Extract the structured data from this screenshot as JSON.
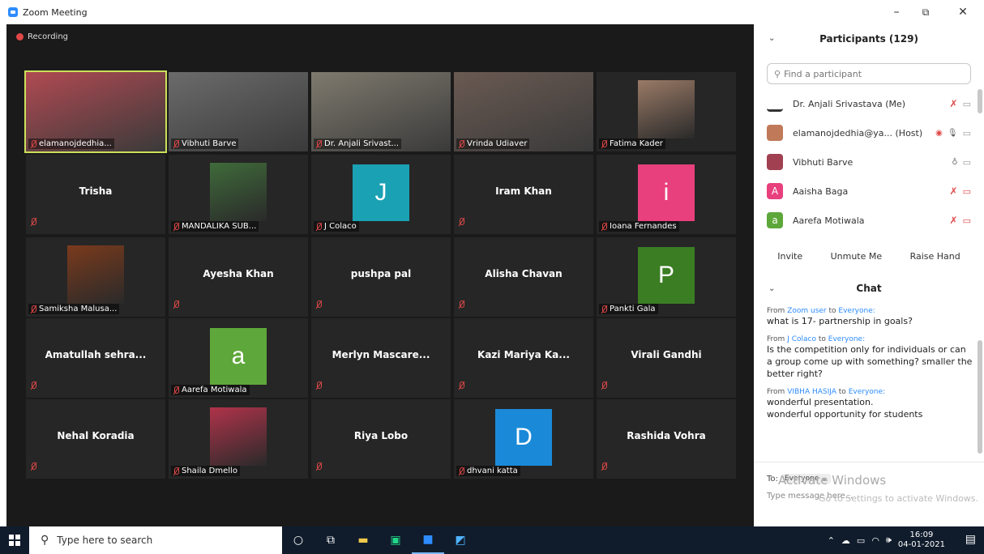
{
  "window": {
    "title": "Zoom Meeting",
    "minimize": "–",
    "maximize": "⧉",
    "close": "✕"
  },
  "video": {
    "recording_label": "Recording",
    "tiles": [
      {
        "name": "elamanojdedhia...",
        "type": "photo",
        "color": "#b04a52"
      },
      {
        "name": "Vibhuti Barve",
        "type": "photo",
        "color": "#6b6b6b"
      },
      {
        "name": "Dr. Anjali Srivast...",
        "type": "photo",
        "color": "#7f7a6e"
      },
      {
        "name": "Vrinda Udiaver",
        "type": "photo",
        "color": "#6a5a52"
      },
      {
        "name": "Fatima Kader",
        "type": "small-photo",
        "color": "#9a7a66"
      },
      {
        "name": "Trisha",
        "type": "name"
      },
      {
        "name": "MANDALIKA SUB...",
        "type": "small-photo",
        "color": "#3f6b3a"
      },
      {
        "name": "J Colaco",
        "type": "letter",
        "letter": "J",
        "color": "#1aa1b4"
      },
      {
        "name": "Iram Khan",
        "type": "name"
      },
      {
        "name": "Ioana Fernandes",
        "type": "letter",
        "letter": "i",
        "color": "#e8407c"
      },
      {
        "name": "Samiksha Malusa...",
        "type": "small-photo",
        "color": "#7a3a1c"
      },
      {
        "name": "Ayesha Khan",
        "type": "name"
      },
      {
        "name": "pushpa pal",
        "type": "name"
      },
      {
        "name": "Alisha Chavan",
        "type": "name"
      },
      {
        "name": "Pankti Gala",
        "type": "letter",
        "letter": "P",
        "color": "#3b7d23"
      },
      {
        "name": "Amatullah sehra...",
        "type": "name"
      },
      {
        "name": "Aarefa Motiwala",
        "type": "letter",
        "letter": "a",
        "color": "#5ea73a"
      },
      {
        "name": "Merlyn Mascare...",
        "type": "name"
      },
      {
        "name": "Kazi Mariya Ka...",
        "type": "name"
      },
      {
        "name": "Virali Gandhi",
        "type": "name"
      },
      {
        "name": "Nehal Koradia",
        "type": "name"
      },
      {
        "name": "Shaila Dmello",
        "type": "small-photo",
        "color": "#b0334a"
      },
      {
        "name": "Riya Lobo",
        "type": "name"
      },
      {
        "name": "dhvani katta",
        "type": "letter",
        "letter": "D",
        "color": "#1a8ad8"
      },
      {
        "name": "Rashida Vohra",
        "type": "name"
      }
    ]
  },
  "participants": {
    "header": "Participants (129)",
    "search_placeholder": "Find a participant",
    "list": [
      {
        "name": "Dr. Anjali Srivastava (Me)",
        "avatar": "",
        "avatar_color": "#333"
      },
      {
        "name": "elamanojdedhia@ya...  (Host)",
        "avatar": "",
        "avatar_color": "#c07a5a"
      },
      {
        "name": "Vibhuti Barve",
        "avatar": "",
        "avatar_color": "#a04050"
      },
      {
        "name": "Aaisha Baga",
        "avatar": "A",
        "avatar_color": "#e8407c"
      },
      {
        "name": "Aarefa Motiwala",
        "avatar": "a",
        "avatar_color": "#5ea73a"
      }
    ],
    "buttons": {
      "invite": "Invite",
      "unmute": "Unmute Me",
      "raise_hand": "Raise Hand"
    }
  },
  "chat": {
    "header": "Chat",
    "messages": [
      {
        "from_prefix": "From",
        "sender": "Zoom user",
        "to_word": "to",
        "to": "Everyone:",
        "text": "what is 17- partnership in goals?"
      },
      {
        "from_prefix": "From",
        "sender": "J Colaco",
        "to_word": "to",
        "to": "Everyone:",
        "text": "Is the competition only for individuals or can a group come up with something? smaller the better right?"
      },
      {
        "from_prefix": "From",
        "sender": "VIBHA HASIJA",
        "to_word": "to",
        "to": "Everyone:",
        "text": "wonderful presentation.\nwonderful opportunity for students"
      }
    ],
    "to_label": "To:",
    "to_value": "Everyone",
    "input_placeholder": "Type message here...",
    "watermark_line1": "Activate Windows",
    "watermark_line2": "Go to Settings to activate Windows."
  },
  "taskbar": {
    "search_placeholder": "Type here to search",
    "time": "16:09",
    "date": "04-01-2021"
  }
}
